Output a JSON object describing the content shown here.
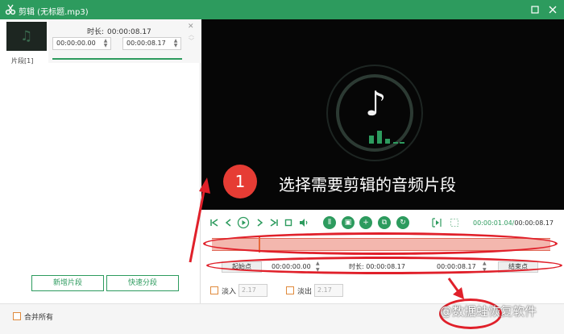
{
  "window": {
    "title": "剪辑 (无标题.mp3)",
    "accent": "#2d9b5e",
    "minimize_icon": "restore-icon",
    "close_icon": "close-icon"
  },
  "segment": {
    "label": "片段[1]",
    "duration_label": "时长:",
    "duration_value": "00:00:08.17",
    "start_time": "00:00:00.00",
    "end_time": "00:00:08.17"
  },
  "left_buttons": {
    "add_segment": "新增片段",
    "quick_split": "快速分段"
  },
  "bottom": {
    "merge_all_label": "合并所有"
  },
  "preview": {
    "annotation_number": "1",
    "annotation_text": "选择需要剪辑的音频片段"
  },
  "playback": {
    "current_time": "00:00:01.04",
    "separator": "/",
    "total_time": "00:00:08.17"
  },
  "trim": {
    "start_point_label": "起始点",
    "start_value": "00:00:00.00",
    "duration_label": "时长:",
    "duration_value": "00:00:08.17",
    "end_value": "00:00:08.17",
    "end_point_label": "结束点"
  },
  "fade": {
    "fade_in_label": "淡入",
    "fade_in_value": "2.17",
    "fade_out_label": "淡出",
    "fade_out_value": "2.17"
  },
  "watermark": "@数据蛙恢复软件"
}
